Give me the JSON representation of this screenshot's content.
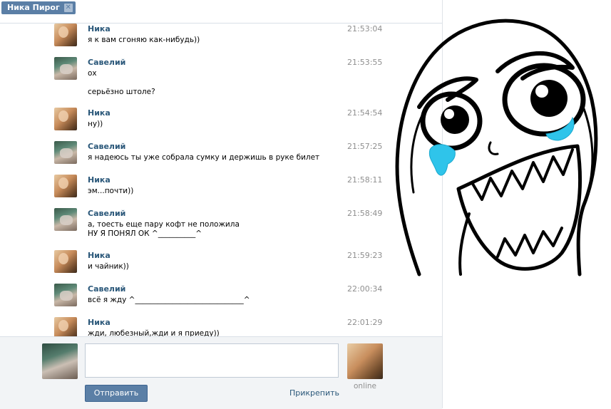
{
  "tab": {
    "title": "Ника Пирог",
    "close": "✕"
  },
  "messages": [
    {
      "author": "Ника",
      "time": "21:53:04",
      "avatar": "nika-avatar",
      "lines": [
        "я к вам сгоняю как-нибудь))"
      ]
    },
    {
      "author": "Савелий",
      "time": "21:53:55",
      "avatar": "savely-avatar",
      "lines": [
        "ох",
        "серьёзно штоле?"
      ]
    },
    {
      "author": "Ника",
      "time": "21:54:54",
      "avatar": "nika-avatar",
      "lines": [
        "ну))"
      ]
    },
    {
      "author": "Савелий",
      "time": "21:57:25",
      "avatar": "savely-avatar",
      "lines": [
        "я надеюсь ты уже собрала сумку и держишь в руке билет"
      ]
    },
    {
      "author": "Ника",
      "time": "21:58:11",
      "avatar": "nika-avatar",
      "lines": [
        "эм...почти))"
      ]
    },
    {
      "author": "Савелий",
      "time": "21:58:49",
      "avatar": "savely-avatar",
      "lines": [
        "а, тоесть еще пару кофт не положила",
        "НУ Я ПОНЯЛ ОК ^__________^"
      ]
    },
    {
      "author": "Ника",
      "time": "21:59:23",
      "avatar": "nika-avatar",
      "lines": [
        "и чайник))"
      ]
    },
    {
      "author": "Савелий",
      "time": "22:00:34",
      "avatar": "savely-avatar",
      "lines": [
        "всё я жду ^_____________________________^"
      ]
    },
    {
      "author": "Ника",
      "time": "22:01:29",
      "avatar": "nika-avatar",
      "lines": [
        "жди, любезный,жди и я приеду))"
      ]
    }
  ],
  "composer": {
    "message_value": "",
    "send_label": "Отправить",
    "attach_label": "Прикрепить",
    "peer_status": "online"
  },
  "colors": {
    "accent": "#5b7fa6",
    "author": "#2b587a",
    "tear": "#2fc4ea"
  }
}
